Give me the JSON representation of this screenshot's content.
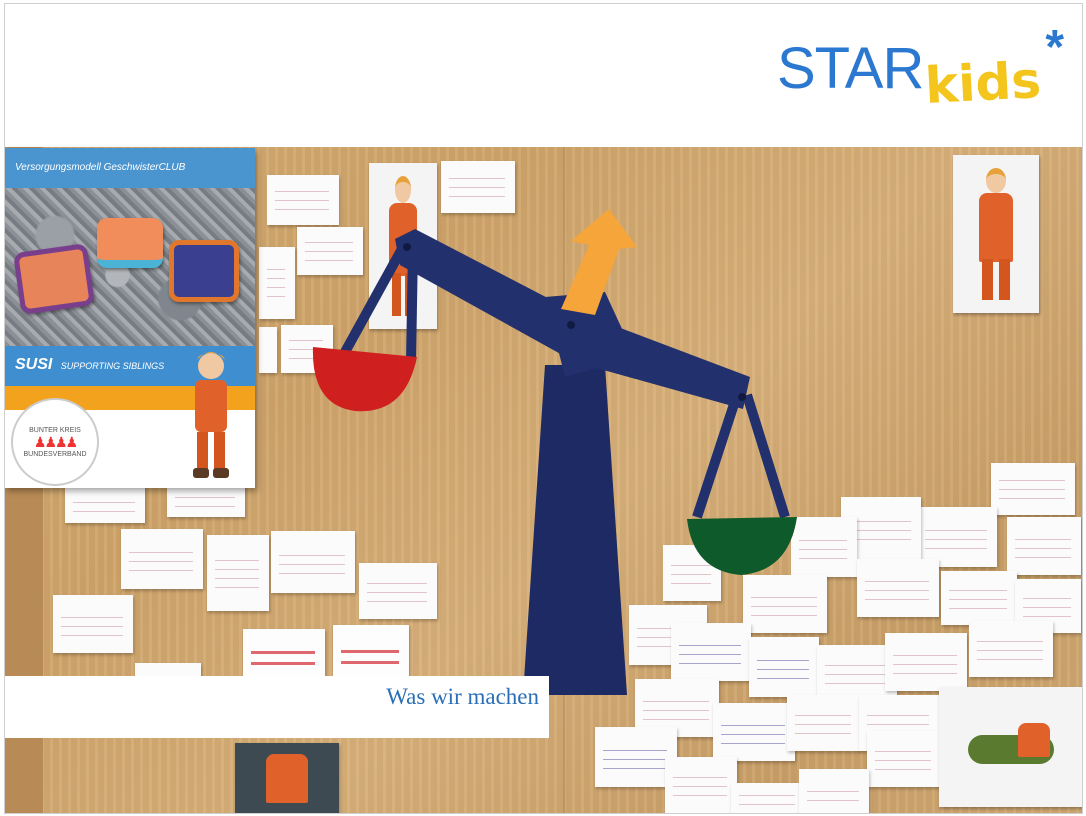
{
  "logo": {
    "part1": "STAR",
    "part2": "kids",
    "colors": {
      "blue": "#2b78d0",
      "yellow": "#f3c51d"
    }
  },
  "brochure": {
    "header": "Versorgungsmodell GeschwisterCLUB",
    "susi": "SUSI",
    "susi_subtitle": "SUPPORTING SIBLINGS",
    "badge_top": "BUNTER KREIS",
    "badge_bottom": "BUNDESVERBAND"
  },
  "caption": "Was wir machen"
}
